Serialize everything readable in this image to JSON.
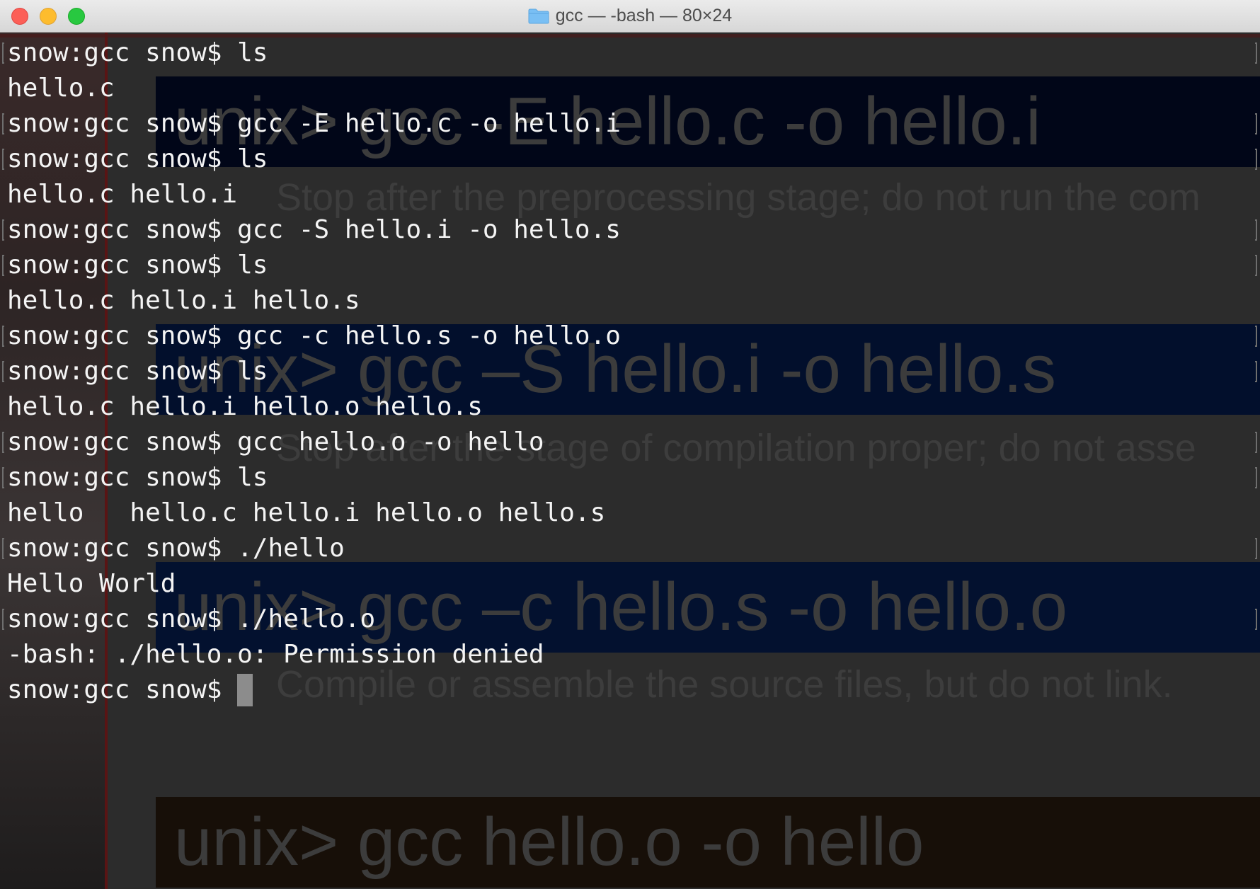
{
  "window": {
    "title": "gcc — -bash — 80×24"
  },
  "icons": {
    "title_folder": "folder-icon"
  },
  "background_slide": {
    "commands": [
      "unix> gcc -E hello.c -o hello.i",
      "unix> gcc –S hello.i -o hello.s",
      "unix> gcc –c hello.s -o hello.o",
      "unix> gcc hello.o -o hello"
    ],
    "descriptions": [
      "Stop after the preprocessing stage; do not run the com",
      "Stop after the stage of compilation proper; do not asse",
      "Compile or assemble the source files, but do not link."
    ]
  },
  "terminal": {
    "lines": [
      "snow:gcc snow$ ls",
      "hello.c",
      "snow:gcc snow$ gcc -E hello.c -o hello.i",
      "snow:gcc snow$ ls",
      "hello.c hello.i",
      "snow:gcc snow$ gcc -S hello.i -o hello.s",
      "snow:gcc snow$ ls",
      "hello.c hello.i hello.s",
      "snow:gcc snow$ gcc -c hello.s -o hello.o",
      "snow:gcc snow$ ls",
      "hello.c hello.i hello.o hello.s",
      "snow:gcc snow$ gcc hello.o -o hello",
      "snow:gcc snow$ ls",
      "hello   hello.c hello.i hello.o hello.s",
      "snow:gcc snow$ ./hello",
      "Hello World",
      "snow:gcc snow$ ./hello.o",
      "-bash: ./hello.o: Permission denied"
    ],
    "prompt": "snow:gcc snow$ "
  },
  "colors": {
    "close": "#fc5f57",
    "minimize": "#fdbc2e",
    "zoom": "#28c840",
    "terminal_text": "#f4f4f4",
    "terminal_bg": "#2c2c2c"
  }
}
